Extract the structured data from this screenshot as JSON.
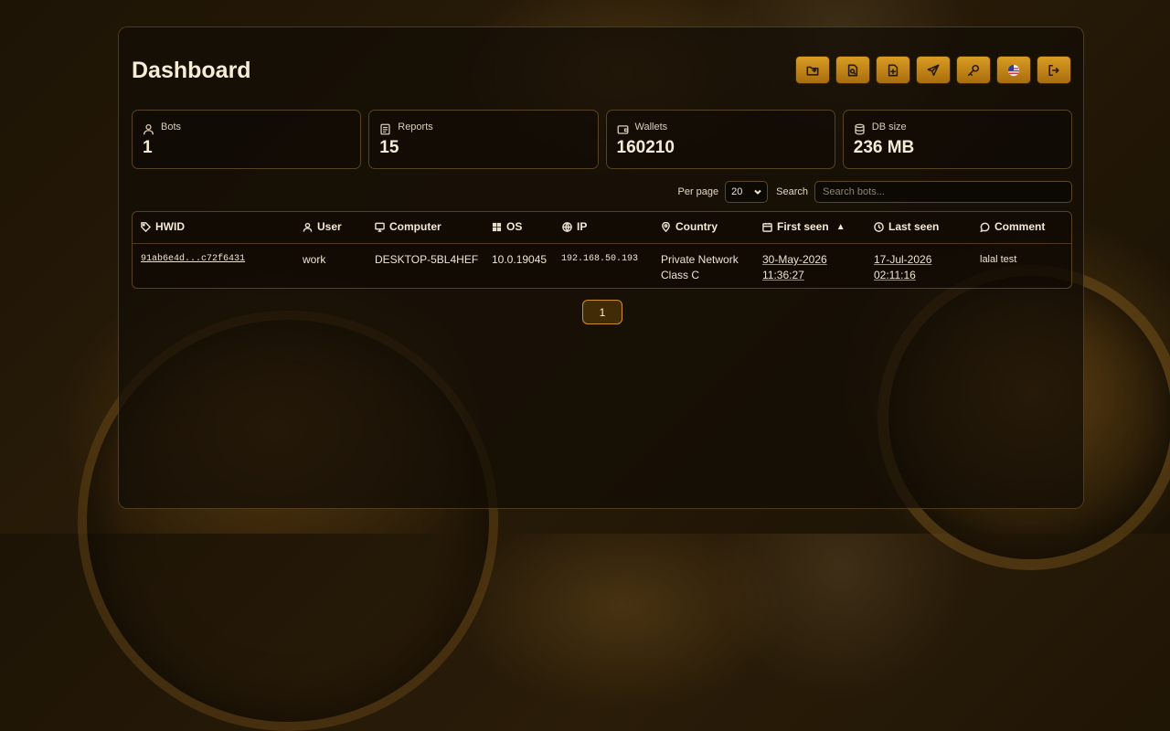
{
  "header": {
    "title": "Dashboard",
    "actions": [
      {
        "name": "folder-export-icon"
      },
      {
        "name": "file-search-icon"
      },
      {
        "name": "file-plus-icon"
      },
      {
        "name": "send-icon"
      },
      {
        "name": "key-icon"
      },
      {
        "name": "us-flag-icon"
      },
      {
        "name": "logout-icon"
      }
    ]
  },
  "stats": [
    {
      "label": "Bots",
      "value": "1",
      "icon": "users-icon"
    },
    {
      "label": "Reports",
      "value": "15",
      "icon": "report-icon"
    },
    {
      "label": "Wallets",
      "value": "160210",
      "icon": "wallet-icon"
    },
    {
      "label": "DB size",
      "value": "236 MB",
      "icon": "database-icon"
    }
  ],
  "controls": {
    "per_page_label": "Per page",
    "per_page_value": "20",
    "search_label": "Search",
    "search_placeholder": "Search bots..."
  },
  "table": {
    "columns": [
      {
        "label": "HWID",
        "icon": "tag-icon"
      },
      {
        "label": "User",
        "icon": "user-icon"
      },
      {
        "label": "Computer",
        "icon": "monitor-icon"
      },
      {
        "label": "OS",
        "icon": "windows-icon"
      },
      {
        "label": "IP",
        "icon": "globe-icon"
      },
      {
        "label": "Country",
        "icon": "map-pin-icon"
      },
      {
        "label": "First seen",
        "icon": "calendar-icon",
        "sort": "▲"
      },
      {
        "label": "Last seen",
        "icon": "clock-icon"
      },
      {
        "label": "Comment",
        "icon": "comment-icon"
      }
    ],
    "rows": [
      {
        "hwid": "91ab6e4d...c72f6431",
        "user": "work",
        "computer": "DESKTOP-5BL4HEF",
        "os": "10.0.19045",
        "ip": "192.168.50.193",
        "country": "Private Network Class C",
        "first_seen_date": "30-May-2026",
        "first_seen_time": "11:36:27",
        "last_seen_date": "17-Jul-2026",
        "last_seen_time": "02:11:16",
        "comment": "lalal test"
      }
    ]
  },
  "pagination": {
    "current": "1"
  },
  "colors": {
    "accent": "#d99c23",
    "accent_dark": "#a86d0e",
    "background": "#1d1406",
    "text": "#f1e6d0"
  }
}
